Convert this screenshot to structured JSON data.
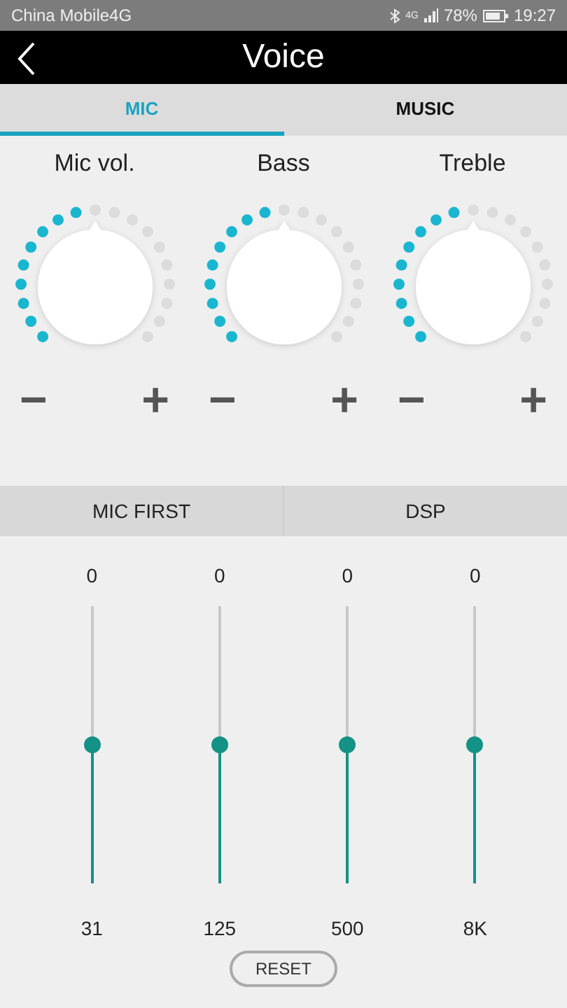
{
  "status_bar": {
    "carrier": "China Mobile4G",
    "network": "4G",
    "battery": "78%",
    "time": "19:27"
  },
  "header": {
    "title": "Voice"
  },
  "tabs": [
    {
      "label": "MIC",
      "selected": true
    },
    {
      "label": "MUSIC",
      "selected": false
    }
  ],
  "knobs": [
    {
      "label": "Mic vol.",
      "minus": "−",
      "plus": "+"
    },
    {
      "label": "Bass",
      "minus": "−",
      "plus": "+"
    },
    {
      "label": "Treble",
      "minus": "−",
      "plus": "+"
    }
  ],
  "modes": [
    {
      "label": "MIC FIRST"
    },
    {
      "label": "DSP"
    }
  ],
  "equalizer": [
    {
      "value": "0",
      "level": 0.5,
      "band": "31"
    },
    {
      "value": "0",
      "level": 0.5,
      "band": "125"
    },
    {
      "value": "0",
      "level": 0.5,
      "band": "500"
    },
    {
      "value": "0",
      "level": 0.5,
      "band": "8K"
    }
  ],
  "reset_button": "RESET"
}
